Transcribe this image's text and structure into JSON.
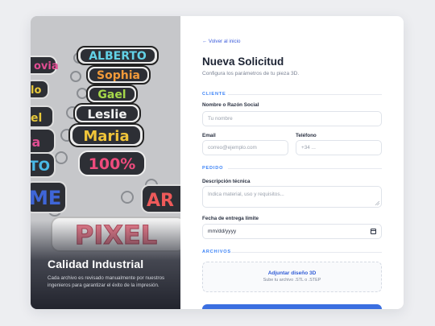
{
  "hero": {
    "title": "Calidad Industrial",
    "description": "Cada archivo es revisado manualmente por nuestros ingenieros para garantizar el éxito de la impresión.",
    "keychains": [
      "ALBERTO",
      "Sophia",
      "Gael",
      "Leslie",
      "Maria",
      "100%",
      "PIXEL",
      "ME",
      "AR",
      "TO",
      "ovia"
    ]
  },
  "form": {
    "back_link": "← Volver al inicio",
    "title": "Nueva Solicitud",
    "subtitle": "Configura los parámetros de tu pieza 3D.",
    "sections": {
      "client": "CLIENTE",
      "order": "PEDIDO",
      "files": "ARCHIVOS"
    },
    "fields": {
      "name": {
        "label": "Nombre o Razón Social",
        "placeholder": "Tu nombre"
      },
      "email": {
        "label": "Email",
        "placeholder": "correo@ejemplo.com"
      },
      "phone": {
        "label": "Teléfono",
        "placeholder": "+34 ..."
      },
      "description": {
        "label": "Descripción técnica",
        "placeholder": "Indica material, uso y requisitos..."
      },
      "deadline": {
        "label": "Fecha de entrega límite",
        "value": "mm/dd/yyyy"
      }
    },
    "upload": {
      "title": "Adjuntar diseño 3D",
      "hint": "Sube tu archivo .STL o .STEP"
    }
  },
  "colors": {
    "accent": "#3b6fe0",
    "section_label": "#3b82f6",
    "link": "#3b5bdb"
  }
}
